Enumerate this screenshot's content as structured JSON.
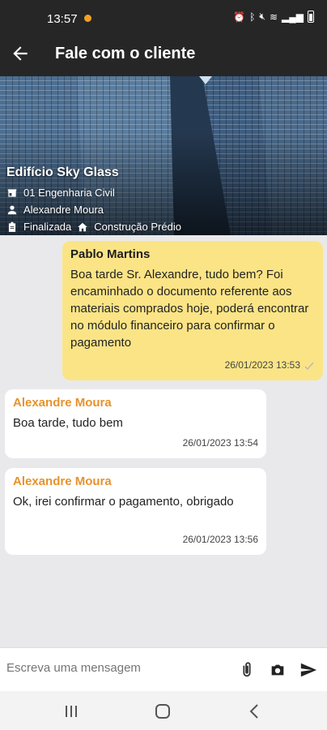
{
  "status_bar": {
    "time": "13:57"
  },
  "app_bar": {
    "title": "Fale com o cliente"
  },
  "project": {
    "name": "Edifício Sky Glass",
    "company": "01 Engenharia Civil",
    "client": "Alexandre Moura",
    "status": "Finalizada",
    "type": "Construção Prédio"
  },
  "messages": [
    {
      "sender": "Pablo Martins",
      "text": "Boa tarde Sr. Alexandre, tudo bem? Foi encaminhado o documento referente aos materiais comprados hoje, poderá encontrar no módulo financeiro para confirmar o pagamento",
      "timestamp": "26/01/2023 13:53",
      "outgoing": true
    },
    {
      "sender": "Alexandre Moura",
      "text": "Boa tarde, tudo bem",
      "timestamp": "26/01/2023 13:54",
      "outgoing": false
    },
    {
      "sender": "Alexandre Moura",
      "text": "Ok, irei confirmar o pagamento, obrigado",
      "timestamp": "26/01/2023 13:56",
      "outgoing": false
    }
  ],
  "composer": {
    "placeholder": "Escreva uma mensagem"
  },
  "colors": {
    "bar": "#262626",
    "outgoing_bubble": "#fbe486",
    "sender_accent": "#e8922c",
    "background": "#e9e9eb"
  },
  "icons": [
    "back-arrow-icon",
    "store-icon",
    "person-icon",
    "clipboard-icon",
    "home-icon",
    "paperclip-icon",
    "camera-icon",
    "send-icon"
  ]
}
